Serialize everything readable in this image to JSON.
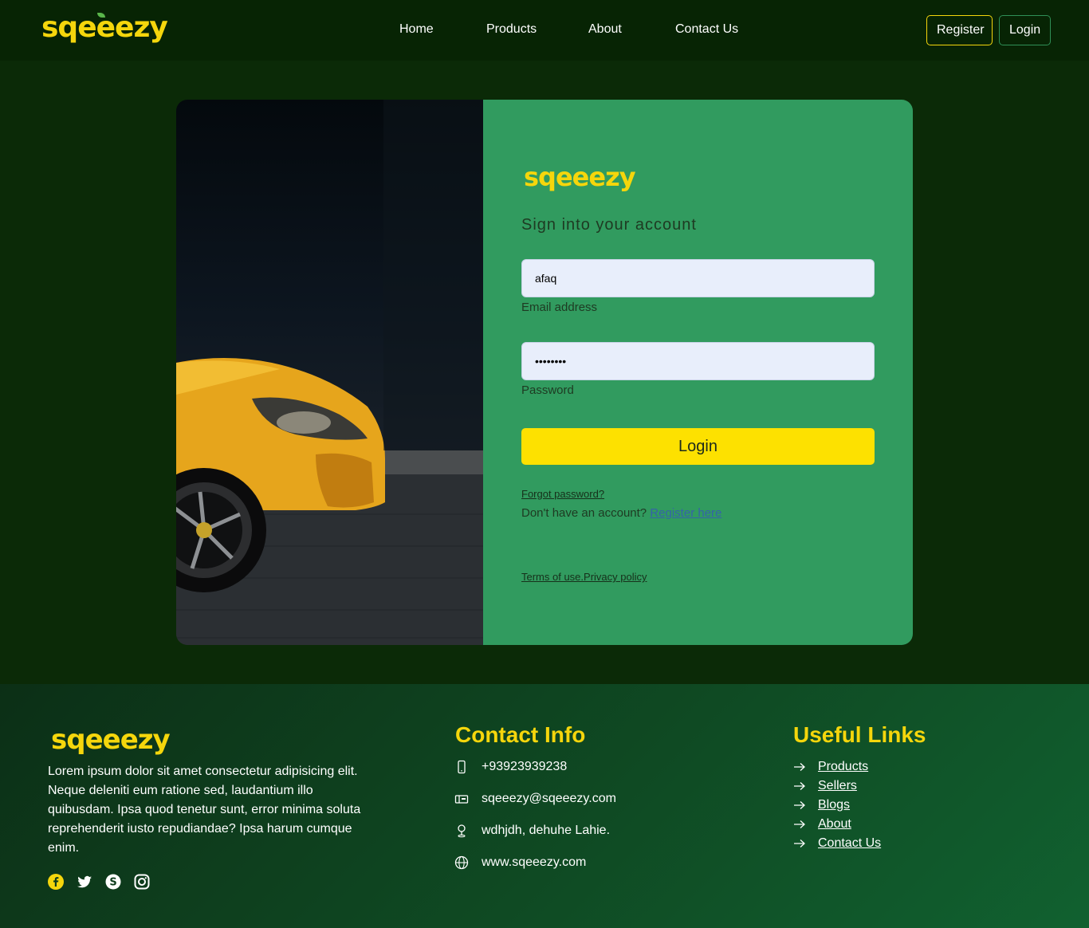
{
  "brand": {
    "name": "sqeeezy"
  },
  "nav": {
    "links": [
      "Home",
      "Products",
      "About",
      "Contact Us"
    ],
    "register_label": "Register",
    "login_label": "Login"
  },
  "login_form": {
    "logo": "sqeeezy",
    "title": "Sign into your account",
    "email_value": "afaq",
    "email_label": "Email address",
    "password_value": "••••••••",
    "password_label": "Password",
    "submit_label": "Login",
    "forgot_label": "Forgot password?",
    "no_account_text": "Don't have an account?",
    "register_link": "Register here",
    "terms_label": "Terms of use.Privacy policy"
  },
  "footer": {
    "logo": "sqeeezy",
    "about": "Lorem ipsum dolor sit amet consectetur adipisicing elit. Neque deleniti eum ratione sed, laudantium illo quibusdam. Ipsa quod tenetur sunt, error minima soluta reprehenderit iusto repudiandae? Ipsa harum cumque enim.",
    "social_icons": [
      "facebook-icon",
      "twitter-icon",
      "skype-icon",
      "instagram-icon"
    ],
    "contact_heading": "Contact Info",
    "contact": {
      "phone": "+93923939238",
      "email": "sqeeezy@sqeeezy.com",
      "address": "wdhjdh, dehuhe Lahie.",
      "website": "www.sqeeezy.com"
    },
    "links_heading": "Useful Links",
    "links": [
      "Products",
      "Sellers",
      "Blogs",
      "About",
      "Contact Us"
    ]
  },
  "colors": {
    "brand_yellow": "#f5d60c",
    "form_green": "#319b5f",
    "page_dark_green": "#0b2a07",
    "button_yellow": "#fde100"
  }
}
